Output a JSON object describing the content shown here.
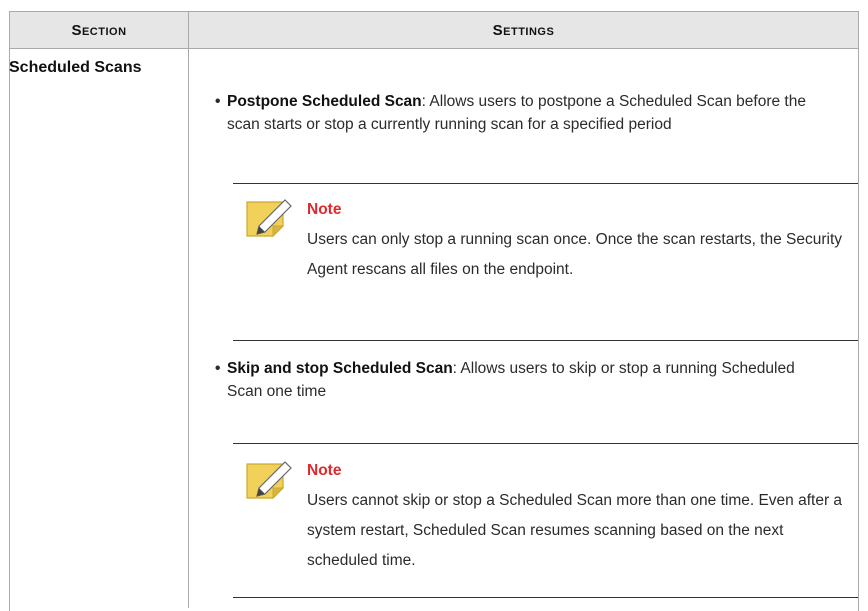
{
  "table": {
    "headers": {
      "section": "Section",
      "settings": "Settings"
    },
    "rows": [
      {
        "section": "Scheduled Scans",
        "settings": [
          {
            "bold": "Postpone Scheduled Scan",
            "text": ": Allows users to postpone a Scheduled Scan before the scan starts or stop a currently running scan for a specified period",
            "note": {
              "title": "Note",
              "body": "Users can only stop a running scan once. Once the scan restarts, the Security Agent rescans all files on the endpoint."
            }
          },
          {
            "bold": "Skip and stop Scheduled Scan",
            "text": ": Allows users to skip or stop a running Scheduled Scan one time",
            "note": {
              "title": "Note",
              "body": "Users cannot skip or stop a Scheduled Scan more than one time. Even after a system restart, Scheduled Scan resumes scanning based on the next scheduled time."
            }
          }
        ]
      }
    ]
  },
  "icons": {
    "note": "note-pencil-icon"
  },
  "colors": {
    "header_bg": "#e6e6e6",
    "note_title": "#e0292e",
    "note_icon": "#f2d15a"
  }
}
